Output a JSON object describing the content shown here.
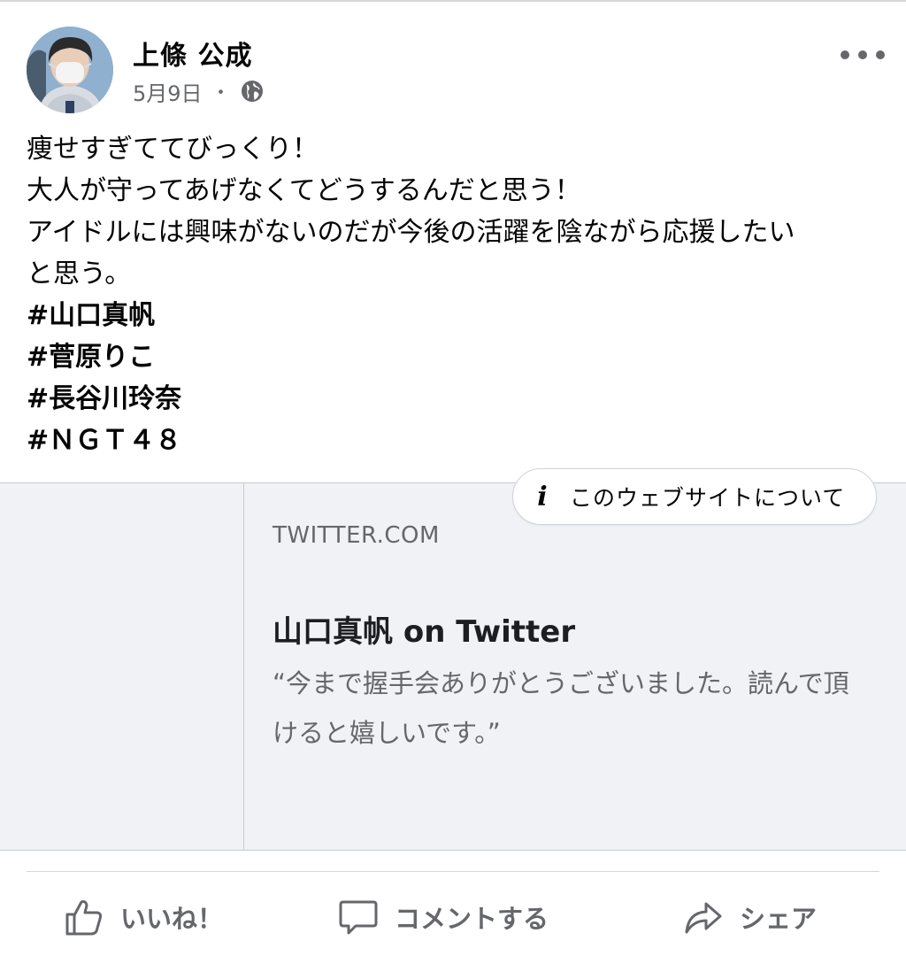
{
  "post": {
    "author": "上條 公成",
    "date": "5月9日",
    "separator": "・",
    "privacy_icon": "globe-icon",
    "more_icon": "more-horizontal-icon",
    "text_lines": [
      "痩せすぎててびっくり！",
      "大人が守ってあげなくてどうするんだと思う！",
      "アイドルには興味がないのだが今後の活躍を陰ながら応援したい",
      "と思う。"
    ],
    "hashtags": [
      "#山口真帆",
      "#菅原りこ",
      "#長谷川玲奈",
      "#ＮＧＴ４８"
    ]
  },
  "link_card": {
    "about_icon": "info-icon",
    "about_label": "このウェブサイトについて",
    "domain": "TWITTER.COM",
    "title": "山口真帆 on Twitter",
    "description": "“今まで握手会ありがとうございました。読んで頂けると嬉しいです。”"
  },
  "actions": {
    "like": "いいね！",
    "comment": "コメントする",
    "share": "シェア"
  },
  "colors": {
    "text_primary": "#050505",
    "text_secondary": "#65676b",
    "card_bg": "#f0f2f5",
    "divider": "#d6d8dc"
  }
}
